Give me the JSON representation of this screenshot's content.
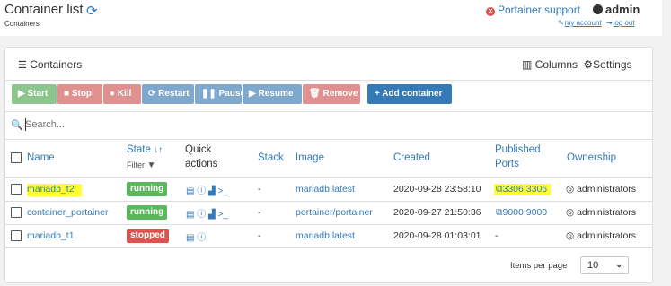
{
  "header": {
    "title": "Container list",
    "subtitle": "Containers",
    "support_label": "Portainer support",
    "username": "admin",
    "my_account": "my account",
    "log_out": "log out"
  },
  "panel": {
    "title": "Containers",
    "columns_label": "Columns",
    "settings_label": "Settings"
  },
  "toolbar": {
    "start": "Start",
    "stop": "Stop",
    "kill": "Kill",
    "restart": "Restart",
    "pause": "Pause",
    "resume": "Resume",
    "remove": "Remove",
    "add_container": "+ Add container"
  },
  "search": {
    "placeholder": "Search..."
  },
  "columns": {
    "name": "Name",
    "state": "State",
    "state_sort": "↓↑",
    "filter": "Filter",
    "quick_actions_1": "Quick",
    "quick_actions_2": "actions",
    "stack": "Stack",
    "image": "Image",
    "created": "Created",
    "published_ports_1": "Published",
    "published_ports_2": "Ports",
    "ownership": "Ownership"
  },
  "rows": [
    {
      "name": "mariadb_t2",
      "state": "running",
      "stack": "-",
      "image": "mariadb:latest",
      "created": "2020-09-28 23:58:10",
      "ports": "3306:3306",
      "ownership": "administrators"
    },
    {
      "name": "container_portainer",
      "state": "running",
      "stack": "-",
      "image": "portainer/portainer",
      "created": "2020-09-27 21:50:36",
      "ports": "9000:9000",
      "ownership": "administrators"
    },
    {
      "name": "mariadb_t1",
      "state": "stopped",
      "stack": "-",
      "image": "mariadb:latest",
      "created": "2020-09-28 01:03:01",
      "ports": "-",
      "ownership": "administrators"
    }
  ],
  "pagination": {
    "items_per_page_label": "Items per page",
    "items_per_page_value": "10"
  },
  "colors": {
    "start": "#8cc68c",
    "stop": "#e0908e",
    "kill": "#e0908e",
    "restart": "#7fa8cf",
    "pause": "#7fa8cf",
    "resume": "#7fa8cf",
    "remove": "#e0908e",
    "add": "#337ab7",
    "running": "#5cb85c",
    "stopped": "#d9534f",
    "link": "#337ab7",
    "highlight": "#ffff33"
  },
  "icons": [
    "refresh-icon",
    "times-circle-icon",
    "user-icon",
    "wrench-icon",
    "sign-out-icon",
    "list-icon",
    "columns-icon",
    "gear-icon",
    "play-icon",
    "stop-icon",
    "bomb-icon",
    "sync-icon",
    "pause-icon",
    "trash-icon",
    "search-icon",
    "sort-icon",
    "filter-icon",
    "file-icon",
    "info-icon",
    "chart-icon",
    "terminal-icon",
    "external-link-icon",
    "eye-slash-icon",
    "chevron-down-icon"
  ]
}
